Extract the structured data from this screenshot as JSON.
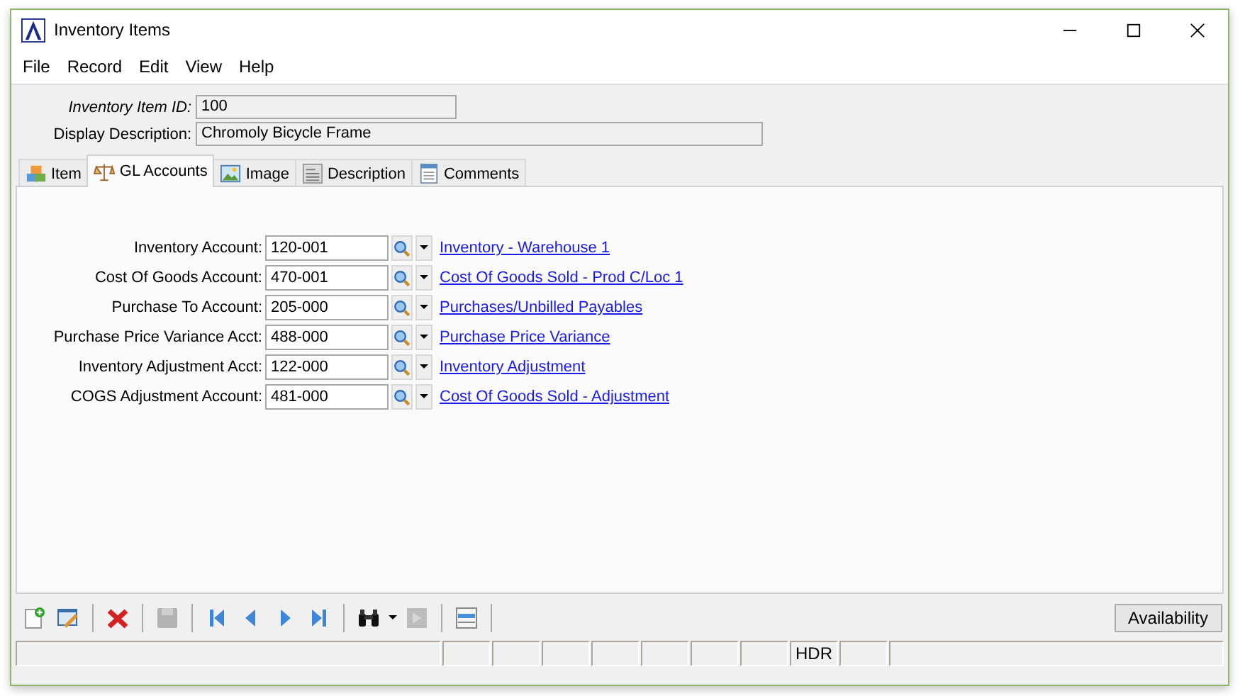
{
  "window": {
    "title": "Inventory Items"
  },
  "menu": [
    "File",
    "Record",
    "Edit",
    "View",
    "Help"
  ],
  "header": [
    {
      "label": "Inventory Item ID:",
      "value": "100",
      "italic": true,
      "wide": false
    },
    {
      "label": "Display Description:",
      "value": "Chromoly Bicycle Frame",
      "italic": false,
      "wide": true
    }
  ],
  "tabs": [
    {
      "label": "Item",
      "kind": "item",
      "selected": false
    },
    {
      "label": "GL Accounts",
      "kind": "scale",
      "selected": true
    },
    {
      "label": "Image",
      "kind": "image",
      "selected": false
    },
    {
      "label": "Description",
      "kind": "text",
      "selected": false
    },
    {
      "label": "Comments",
      "kind": "notes",
      "selected": false
    }
  ],
  "accounts": [
    {
      "label": "Inventory Account:",
      "value": "120-001",
      "link": "Inventory - Warehouse 1"
    },
    {
      "label": "Cost Of Goods Account:",
      "value": "470-001",
      "link": "Cost Of Goods Sold - Prod C/Loc 1"
    },
    {
      "label": "Purchase To Account:",
      "value": "205-000",
      "link": "Purchases/Unbilled Payables"
    },
    {
      "label": "Purchase Price Variance Acct:",
      "value": "488-000",
      "link": "Purchase Price Variance"
    },
    {
      "label": "Inventory Adjustment Acct:",
      "value": "122-000",
      "link": "Inventory Adjustment"
    },
    {
      "label": "COGS Adjustment Account:",
      "value": "481-000",
      "link": "Cost Of Goods Sold - Adjustment"
    }
  ],
  "toolbar": [
    {
      "kind": "new",
      "disabled": false
    },
    {
      "kind": "edit",
      "disabled": false
    },
    {
      "kind": "sep"
    },
    {
      "kind": "delete",
      "disabled": false
    },
    {
      "kind": "sep"
    },
    {
      "kind": "save",
      "disabled": true
    },
    {
      "kind": "sep"
    },
    {
      "kind": "first",
      "disabled": false
    },
    {
      "kind": "prev",
      "disabled": false
    },
    {
      "kind": "next",
      "disabled": false
    },
    {
      "kind": "last",
      "disabled": false
    },
    {
      "kind": "sep"
    },
    {
      "kind": "find",
      "disabled": false
    },
    {
      "kind": "goto",
      "disabled": true
    },
    {
      "kind": "sep"
    },
    {
      "kind": "list",
      "disabled": false
    },
    {
      "kind": "sep"
    }
  ],
  "availability_button": "Availability",
  "status_bar": {
    "hdr": "HDR"
  }
}
